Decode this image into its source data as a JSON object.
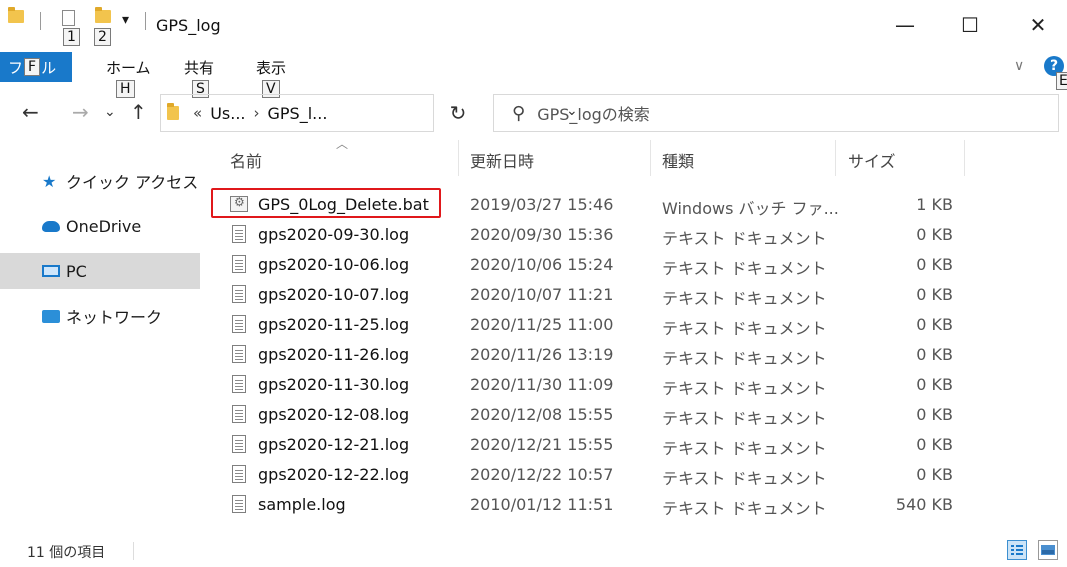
{
  "window": {
    "title": "GPS_log",
    "minimize_glyph": "—",
    "maximize_glyph": "☐",
    "close_glyph": "✕",
    "qat_dropdown_glyph": "▾"
  },
  "keytips": {
    "qat1": "1",
    "qat2": "2",
    "file": "F",
    "home": "H",
    "share": "S",
    "view": "V",
    "help": "E"
  },
  "ribbon": {
    "file_tab": "ファイル",
    "file_tab_pre": "フ",
    "file_tab_post": "ル",
    "tabs": [
      "ホーム",
      "共有",
      "表示"
    ],
    "collapse_glyph": "∨",
    "help_glyph": "?"
  },
  "address": {
    "back_glyph": "←",
    "forward_glyph": "→",
    "recent_glyph": "⌄",
    "up_glyph": "↑",
    "overflow_glyph": "«",
    "separator_glyph": "›",
    "parts": [
      "Us...",
      "GPS_l..."
    ],
    "dropdown_glyph": "⌄",
    "refresh_glyph": "↻"
  },
  "search": {
    "icon_glyph": "⚲",
    "placeholder": "GPS_logの検索"
  },
  "sidebar": {
    "items": [
      {
        "label": "クイック アクセス",
        "icon": "star-icon"
      },
      {
        "label": "OneDrive",
        "icon": "cloud-icon"
      },
      {
        "label": "PC",
        "icon": "pc-icon"
      },
      {
        "label": "ネットワーク",
        "icon": "network-icon"
      }
    ]
  },
  "columns": {
    "name": "名前",
    "date": "更新日時",
    "type": "種類",
    "size": "サイズ",
    "sort_glyph": "︿"
  },
  "files": [
    {
      "name": "GPS_0Log_Delete.bat",
      "date": "2019/03/27 15:46",
      "type": "Windows バッチ ファ...",
      "size": "1 KB"
    },
    {
      "name": "gps2020-09-30.log",
      "date": "2020/09/30 15:36",
      "type": "テキスト ドキュメント",
      "size": "0 KB"
    },
    {
      "name": "gps2020-10-06.log",
      "date": "2020/10/06 15:24",
      "type": "テキスト ドキュメント",
      "size": "0 KB"
    },
    {
      "name": "gps2020-10-07.log",
      "date": "2020/10/07 11:21",
      "type": "テキスト ドキュメント",
      "size": "0 KB"
    },
    {
      "name": "gps2020-11-25.log",
      "date": "2020/11/25 11:00",
      "type": "テキスト ドキュメント",
      "size": "0 KB"
    },
    {
      "name": "gps2020-11-26.log",
      "date": "2020/11/26 13:19",
      "type": "テキスト ドキュメント",
      "size": "0 KB"
    },
    {
      "name": "gps2020-11-30.log",
      "date": "2020/11/30 11:09",
      "type": "テキスト ドキュメント",
      "size": "0 KB"
    },
    {
      "name": "gps2020-12-08.log",
      "date": "2020/12/08 15:55",
      "type": "テキスト ドキュメント",
      "size": "0 KB"
    },
    {
      "name": "gps2020-12-21.log",
      "date": "2020/12/21 15:55",
      "type": "テキスト ドキュメント",
      "size": "0 KB"
    },
    {
      "name": "gps2020-12-22.log",
      "date": "2020/12/22 10:57",
      "type": "テキスト ドキュメント",
      "size": "0 KB"
    },
    {
      "name": "sample.log",
      "date": "2010/01/12 11:51",
      "type": "テキスト ドキュメント",
      "size": "540 KB"
    }
  ],
  "status": {
    "item_count": "11 個の項目"
  },
  "colors": {
    "accent": "#1979ca",
    "highlight_border": "#e0181b",
    "selected_sidebar": "#d9d9d9"
  }
}
